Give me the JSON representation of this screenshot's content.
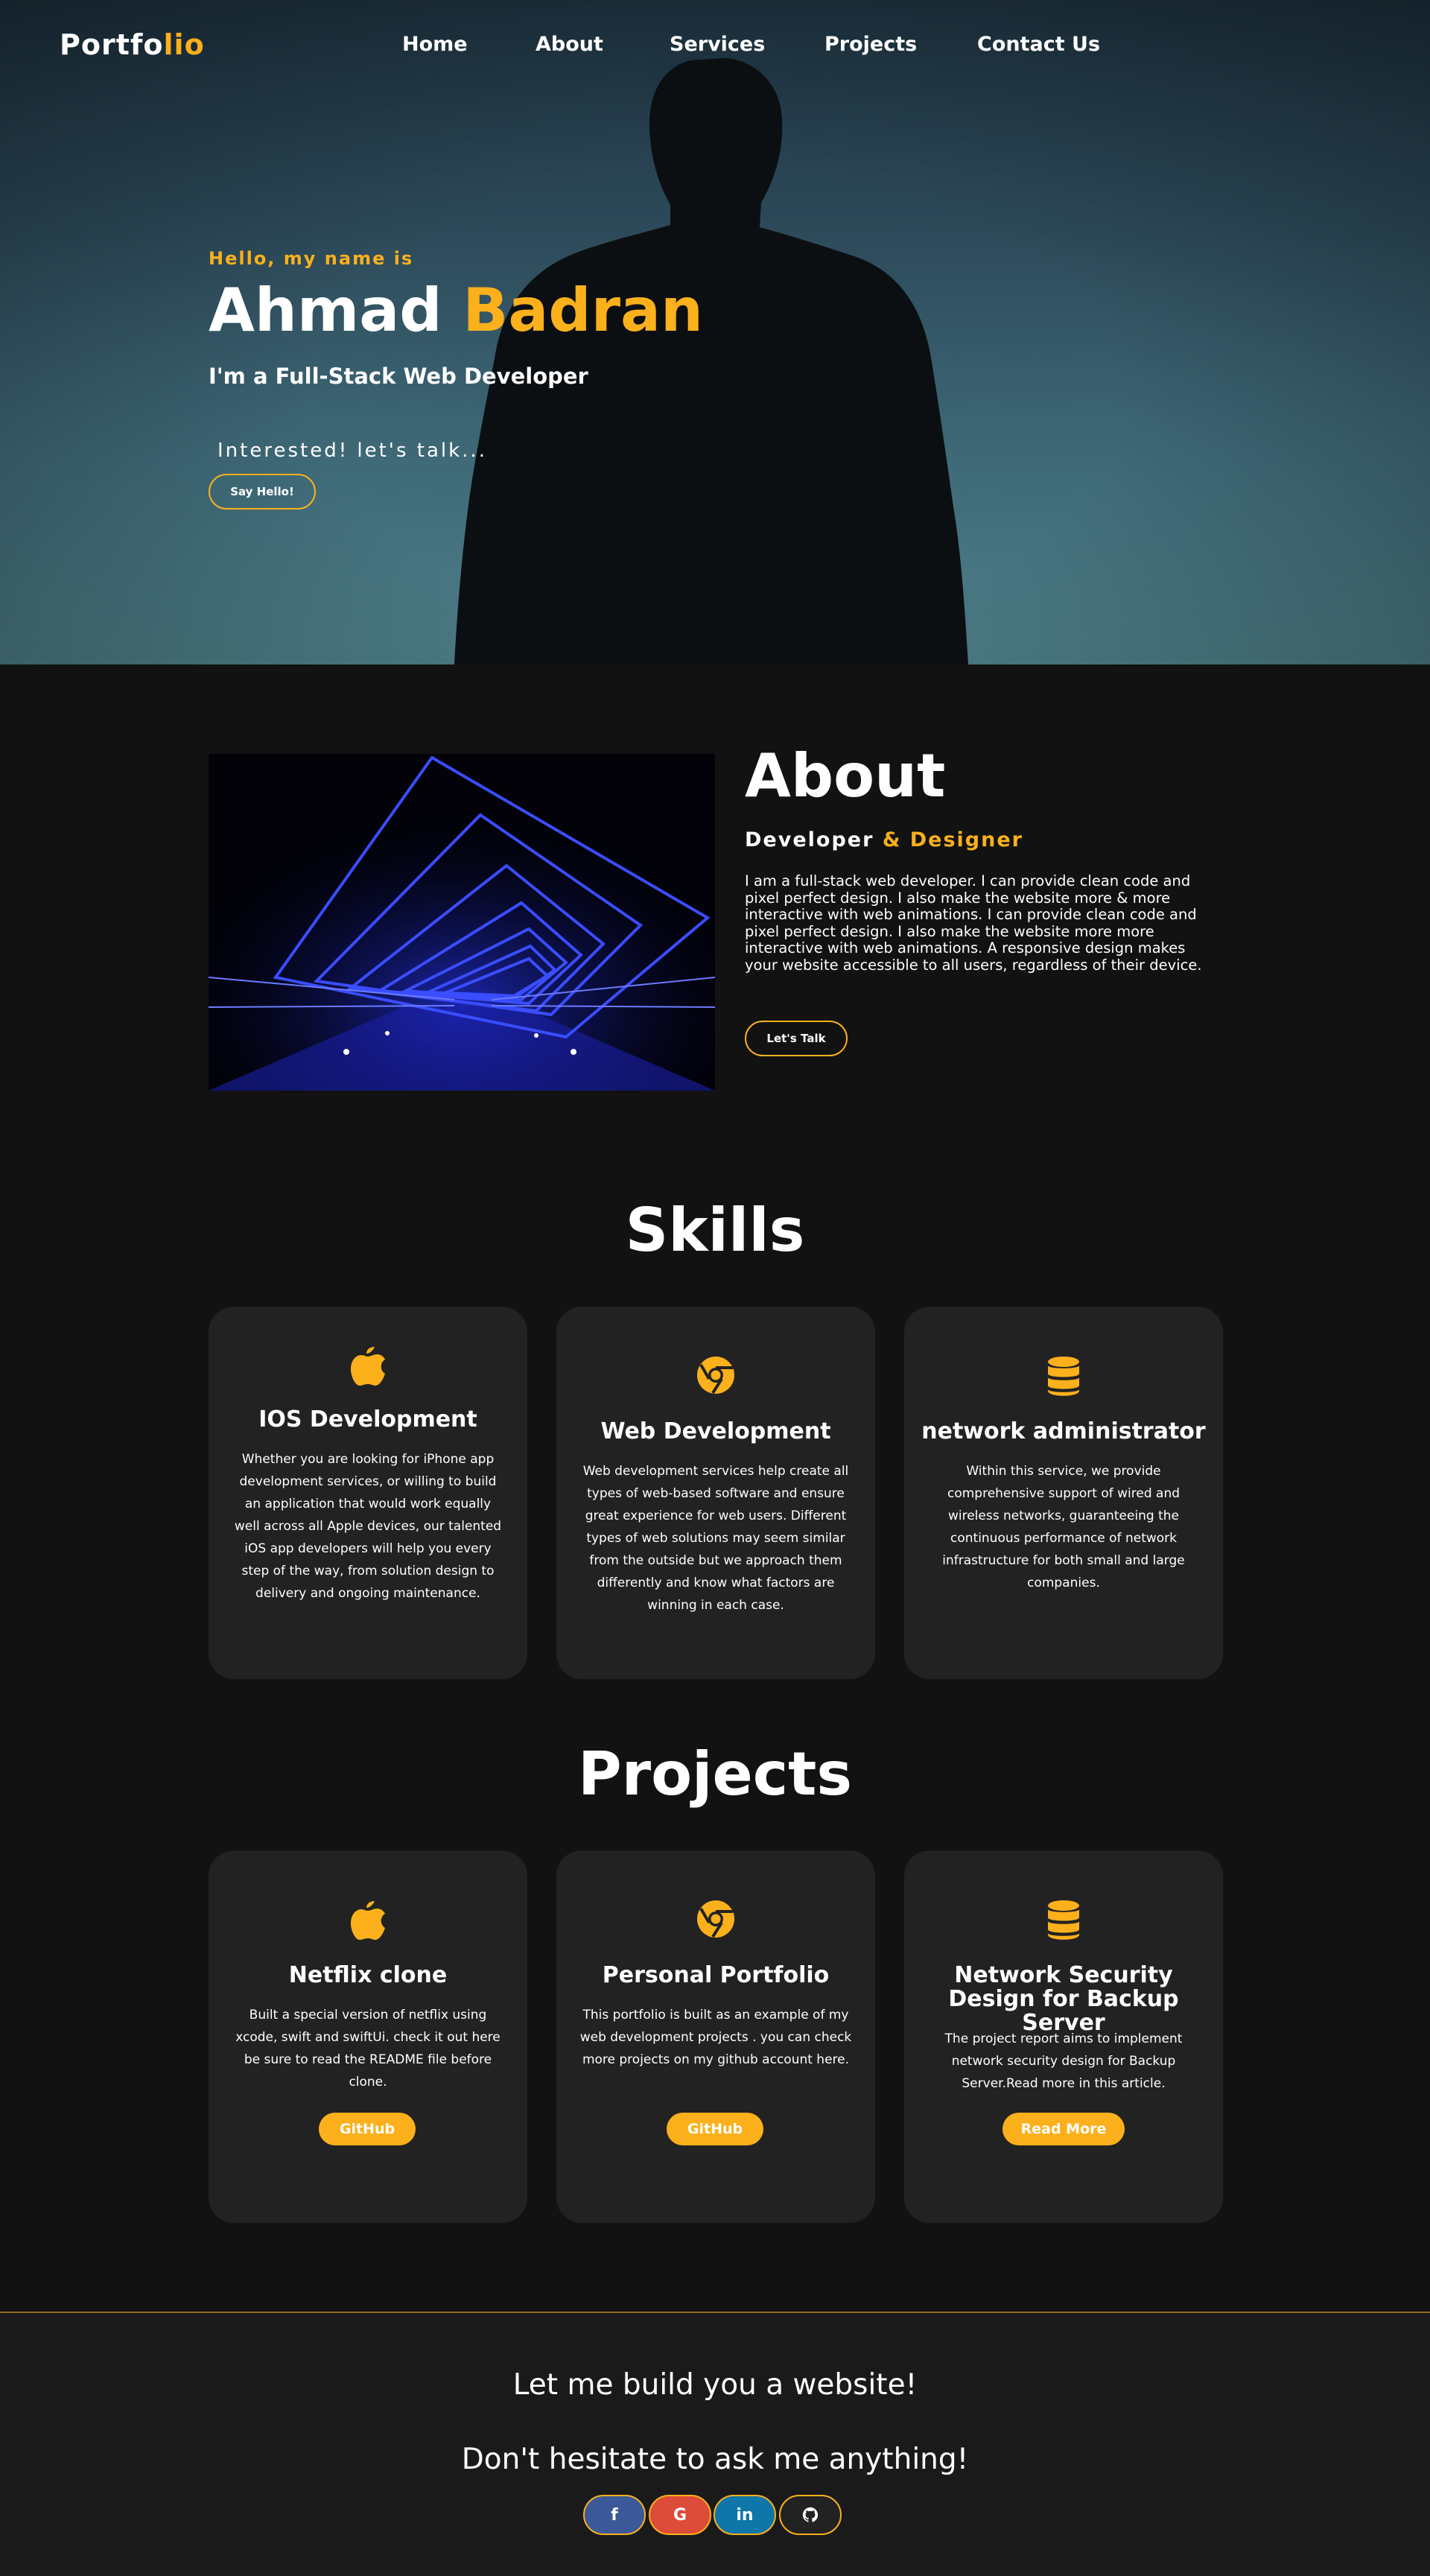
{
  "logo": {
    "text": "Portfo",
    "accent": "lio"
  },
  "nav": [
    "Home",
    "About",
    "Services",
    "Projects",
    "Contact Us"
  ],
  "hero": {
    "hello": "Hello, my name is",
    "first_name": "Ahmad",
    "last_name": "Badran",
    "role": "I'm a Full-Stack Web Developer",
    "interest": "Interested! let's talk...",
    "button": "Say Hello!"
  },
  "about": {
    "title": "About",
    "sub_plain": "Developer",
    "sub_accent": "& Designer",
    "text": "I am a full-stack web developer. I can provide clean code and pixel perfect design. I also make the website more & more interactive with web animations. I can provide clean code and pixel perfect design. I also make the website more more interactive with web animations. A responsive design makes your website accessible to all users, regardless of their device.",
    "button": "Let's Talk"
  },
  "skills": {
    "title": "Skills",
    "cards": [
      {
        "icon": "apple-icon",
        "title": "IOS Development",
        "text": "Whether you are looking for iPhone app development services, or willing to build an application that would work equally well across all Apple devices, our talented iOS app developers will help you every step of the way, from solution design to delivery and ongoing maintenance."
      },
      {
        "icon": "chrome-icon",
        "title": "Web Development",
        "text": "Web development services help create all types of web-based software and ensure great experience for web users. Different types of web solutions may seem similar from the outside but we approach them differently and know what factors are winning in each case."
      },
      {
        "icon": "database-icon",
        "title": "network administrator",
        "text": "Within this service, we provide comprehensive support of wired and wireless networks, guaranteeing the continuous performance of network infrastructure for both small and large companies."
      }
    ]
  },
  "projects": {
    "title": "Projects",
    "cards": [
      {
        "icon": "apple-icon",
        "title": "Netflix clone",
        "text": "Built a special version of netflix using xcode, swift and swiftUi. check it out here be sure to read the README file before clone.",
        "button": "GitHub"
      },
      {
        "icon": "chrome-icon",
        "title": "Personal Portfolio",
        "text": "This portfolio is built as an example of my web development projects . you can check more projects on my github account here.",
        "button": "GitHub"
      },
      {
        "icon": "database-icon",
        "title": "Network Security Design for Backup Server",
        "text": "The project report aims to implement network security design for Backup Server.Read more in this article.",
        "button": "Read More"
      }
    ]
  },
  "footer": {
    "line1": "Let me build you a website!",
    "line2": "Don't hesitate to ask me anything!",
    "social": [
      {
        "icon": "facebook-icon",
        "glyph": "f",
        "color": "#3b5998"
      },
      {
        "icon": "google-icon",
        "glyph": "G",
        "color": "#dd4b39"
      },
      {
        "icon": "linkedin-icon",
        "glyph": "in",
        "color": "#0e76a8"
      },
      {
        "icon": "github-icon",
        "glyph": "",
        "color": "#222222"
      }
    ]
  },
  "colors": {
    "accent": "#fbb01c",
    "background": "#121212",
    "card": "#222222"
  }
}
